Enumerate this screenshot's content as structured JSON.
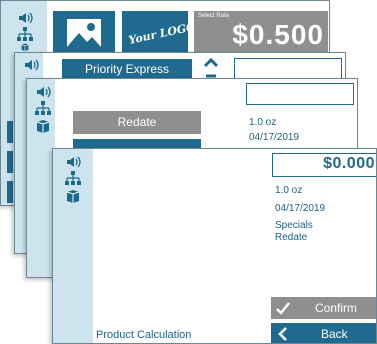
{
  "screen1": {
    "logo_text": "Your LOGO",
    "rate_label": "Select Rate",
    "rate_value": "$0.500",
    "icons": [
      "speaker-icon",
      "network-icon",
      "package-icon"
    ]
  },
  "screen2": {
    "service_button": "Priority Express"
  },
  "screen3": {
    "redate_button": "Redate",
    "weight": "1.0 oz",
    "date": "04/17/2019"
  },
  "screen4": {
    "amount": "$0.000",
    "weight": "1.0 oz",
    "date": "04/17/2019",
    "specials": "Specials",
    "redate": "Redate",
    "confirm_label": "Confirm",
    "back_label": "Back",
    "footer_title": "Product Calculation"
  },
  "colors": {
    "teal": "#1f6a8e",
    "sidebar": "#cde4ee",
    "gray_button": "#8f8f8f",
    "text": "#1f5f84"
  }
}
